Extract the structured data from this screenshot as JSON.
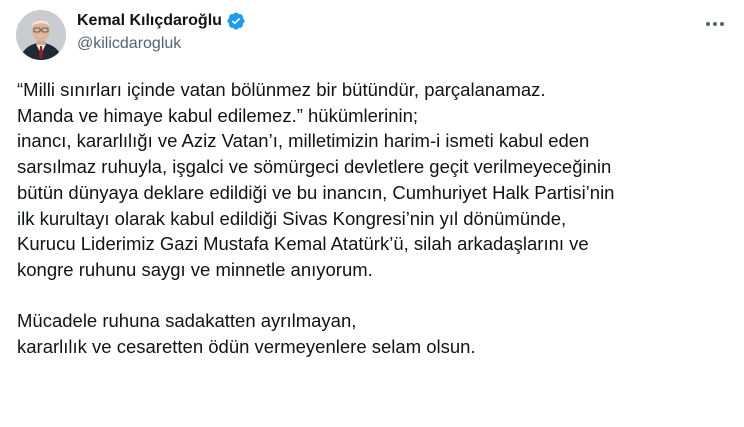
{
  "author": {
    "display_name": "Kemal Kılıçdaroğlu",
    "handle": "@kilicdarogluk",
    "verified_icon": "verified-badge-icon",
    "avatar_icon": "profile-photo"
  },
  "actions": {
    "more_icon": "more-options-icon"
  },
  "tweet": {
    "paragraph1": [
      "“Milli sınırları içinde vatan bölünmez bir bütündür, parçalanamaz.",
      "Manda ve himaye kabul edilemez.” hükümlerinin;",
      "inancı, kararlılığı ve Aziz Vatan’ı, milletimizin harim-i ismeti kabul eden",
      "sarsılmaz ruhuyla, işgalci ve sömürgeci devletlere geçit verilmeyeceğinin",
      "bütün dünyaya deklare edildiği ve bu inancın, Cumhuriyet Halk Partisi’nin",
      "ilk kurultayı olarak kabul edildiği Sivas Kongresi’nin yıl dönümünde,",
      "Kurucu Liderimiz Gazi Mustafa Kemal Atatürk’ü, silah arkadaşlarını ve",
      "kongre ruhunu saygı ve minnetle anıyorum."
    ],
    "paragraph2": [
      "Mücadele ruhuna sadakatten ayrılmayan,",
      "kararlılık ve cesaretten ödün vermeyenlere selam olsun."
    ]
  },
  "colors": {
    "text": "#0f1419",
    "secondary": "#536471",
    "verified": "#1d9bf0"
  }
}
